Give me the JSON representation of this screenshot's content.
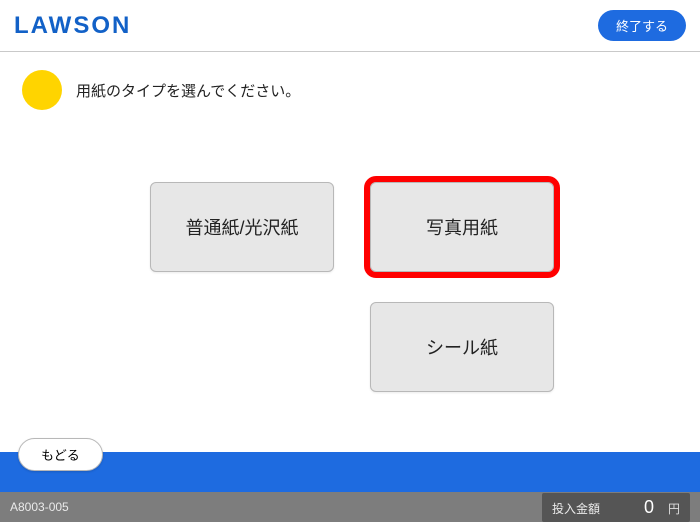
{
  "header": {
    "logo": "LAWSON",
    "end_label": "終了する"
  },
  "prompt": {
    "text": "用紙のタイプを選んでください。"
  },
  "options": {
    "plain_gloss": "普通紙/光沢紙",
    "photo": "写真用紙",
    "seal": "シール紙"
  },
  "bottom": {
    "back_label": "もどる"
  },
  "footer": {
    "screen_id": "A8003-005",
    "deposit_label": "投入金額",
    "deposit_amount": "0",
    "deposit_unit": "円"
  }
}
